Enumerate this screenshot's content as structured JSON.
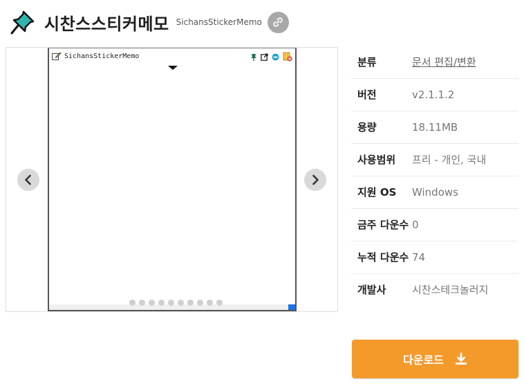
{
  "header": {
    "app_icon": "pushpin-icon",
    "title": "시찬스스티커메모",
    "subtitle": "SichansStickerMemo",
    "link_icon": "link-icon"
  },
  "gallery": {
    "window_title": "SichansStickerMemo",
    "tool_icons": [
      "pin-icon",
      "popout-icon",
      "minimize-circle-icon",
      "delete-note-icon"
    ],
    "dot_count": 10,
    "prev_icon": "chevron-left-icon",
    "next_icon": "chevron-right-icon"
  },
  "info": {
    "rows": [
      {
        "label": "분류",
        "value": "문서 편집/변환"
      },
      {
        "label": "버전",
        "value": "v2.1.1.2"
      },
      {
        "label": "용량",
        "value": "18.11MB"
      },
      {
        "label": "사용범위",
        "value": "프리 - 개인, 국내"
      },
      {
        "label": "지원 OS",
        "value": "Windows"
      },
      {
        "label": "금주 다운수",
        "value": "0"
      },
      {
        "label": "누적 다운수",
        "value": "74"
      },
      {
        "label": "개발사",
        "value": "시찬스테크놀러지"
      }
    ]
  },
  "download": {
    "label": "다운로드",
    "icon": "download-icon"
  },
  "colors": {
    "accent": "#f49a2b",
    "icon_teal": "#2fb5b0",
    "scroll_thumb": "#1a73e8"
  }
}
